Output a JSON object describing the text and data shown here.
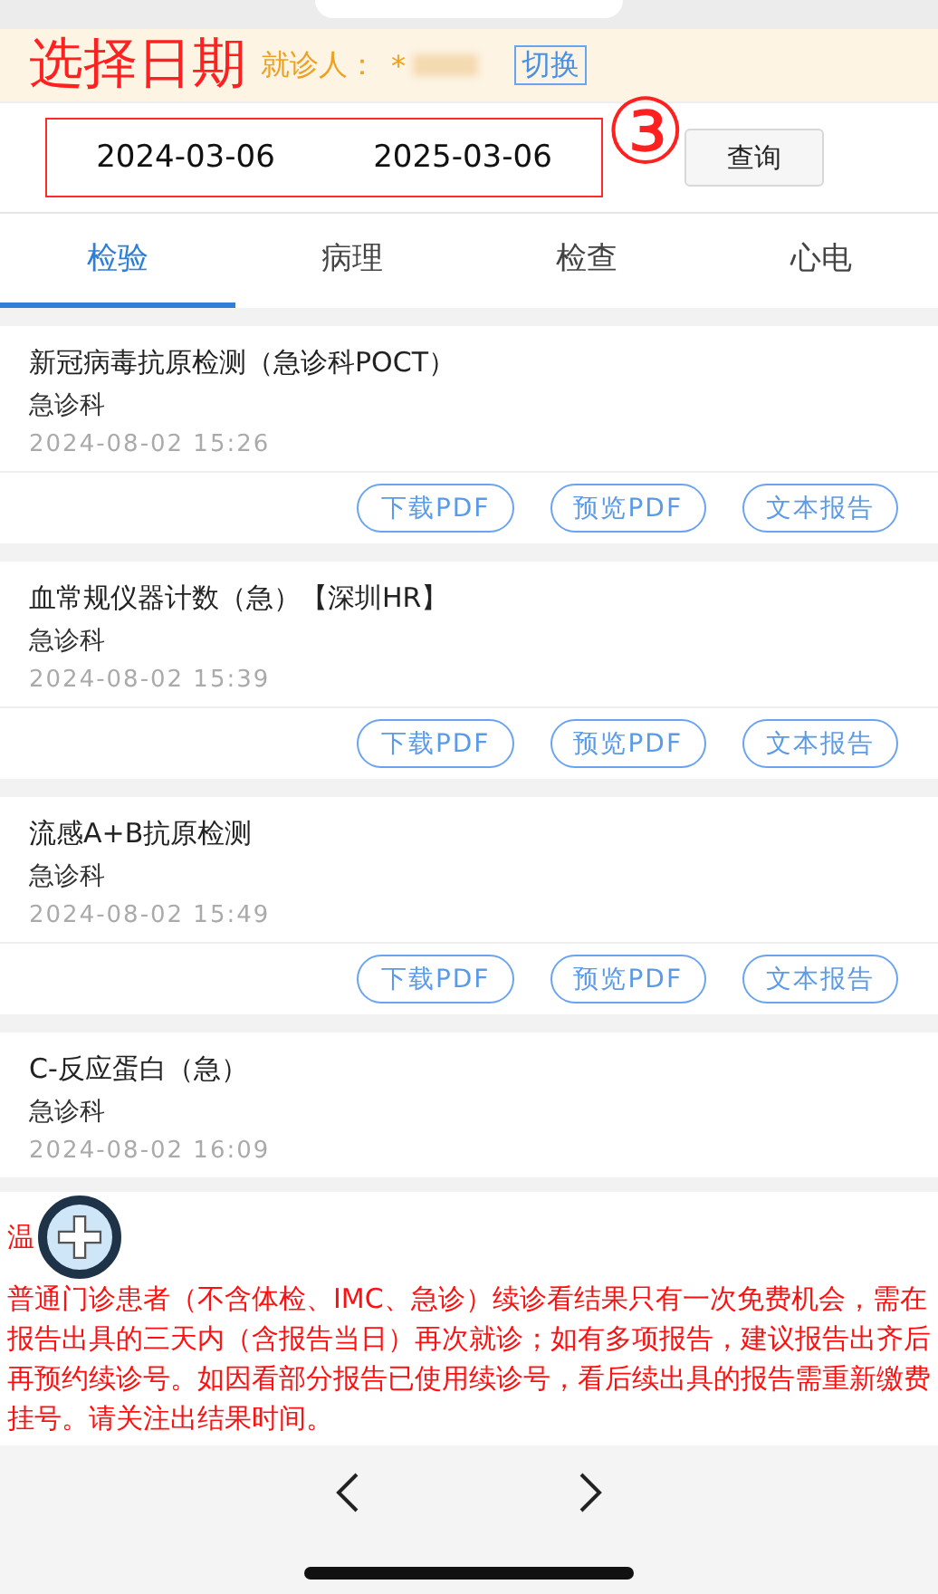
{
  "header": {
    "title": "选择日期",
    "patient_label": "就诊人：",
    "patient_name": "*",
    "switch_button": "切换"
  },
  "date_range": {
    "start": "2024-03-06",
    "end": "2025-03-06"
  },
  "annotation": "③",
  "query_button": "查询",
  "tabs": [
    {
      "label": "检验",
      "selected": true
    },
    {
      "label": "病理",
      "selected": false
    },
    {
      "label": "检查",
      "selected": false
    },
    {
      "label": "心电",
      "selected": false
    }
  ],
  "reports": [
    {
      "title": "新冠病毒抗原检测（急诊科POCT）",
      "department": "急诊科",
      "time": "2024-08-02  15:26",
      "actions": [
        "下载PDF",
        "预览PDF",
        "文本报告"
      ]
    },
    {
      "title": "血常规仪器计数（急）【深圳HR】",
      "department": "急诊科",
      "time": "2024-08-02  15:39",
      "actions": [
        "下载PDF",
        "预览PDF",
        "文本报告"
      ]
    },
    {
      "title": "流感A+B抗原检测",
      "department": "急诊科",
      "time": "2024-08-02  15:49",
      "actions": [
        "下载PDF",
        "预览PDF",
        "文本报告"
      ]
    },
    {
      "title": "C-反应蛋白（急）",
      "department": "急诊科",
      "time": "2024-08-02  16:09"
    }
  ],
  "notice": {
    "heading": "温",
    "body": "普通门诊患者（不含体检、IMC、急诊）续诊看结果只有一次免费机会，需在报告出具的三天内（含报告当日）再次就诊；如有多项报告，建议报告出齐后再预约续诊号。如因看部分报告已使用续诊号，看后续出具的报告需重新缴费挂号。请关注出结果时间。"
  }
}
